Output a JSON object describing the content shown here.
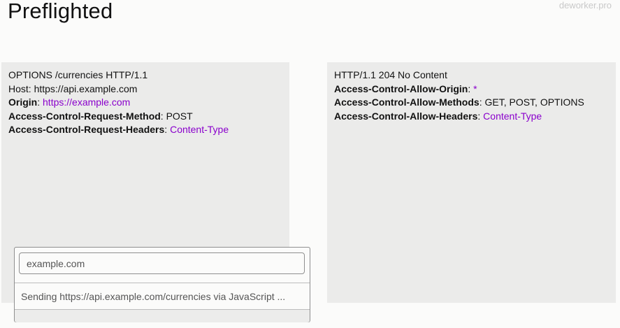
{
  "page": {
    "title": "Preflighted",
    "watermark": "deworker.pro"
  },
  "request": {
    "request_line": "OPTIONS /currencies HTTP/1.1",
    "host_line": "Host: https://api.example.com",
    "origin_key": "Origin",
    "origin_value": "https://example.com",
    "method_key": "Access-Control-Request-Method",
    "method_value": "POST",
    "headers_key": "Access-Control-Request-Headers",
    "headers_value": "Content-Type"
  },
  "response": {
    "status_line": "HTTP/1.1 204 No Content",
    "allow_origin_key": "Access-Control-Allow-Origin",
    "allow_origin_value": "*",
    "allow_methods_key": "Access-Control-Allow-Methods",
    "allow_methods_value": "GET, POST, OPTIONS",
    "allow_headers_key": "Access-Control-Allow-Headers",
    "allow_headers_value": "Content-Type"
  },
  "browser_popup": {
    "url_value": "example.com",
    "status_text": "Sending https://api.example.com/currencies via JavaScript ..."
  },
  "colors": {
    "panel_bg": "#ebebea",
    "header_value": "#8a00cc",
    "page_bg": "#fbfbfa"
  }
}
